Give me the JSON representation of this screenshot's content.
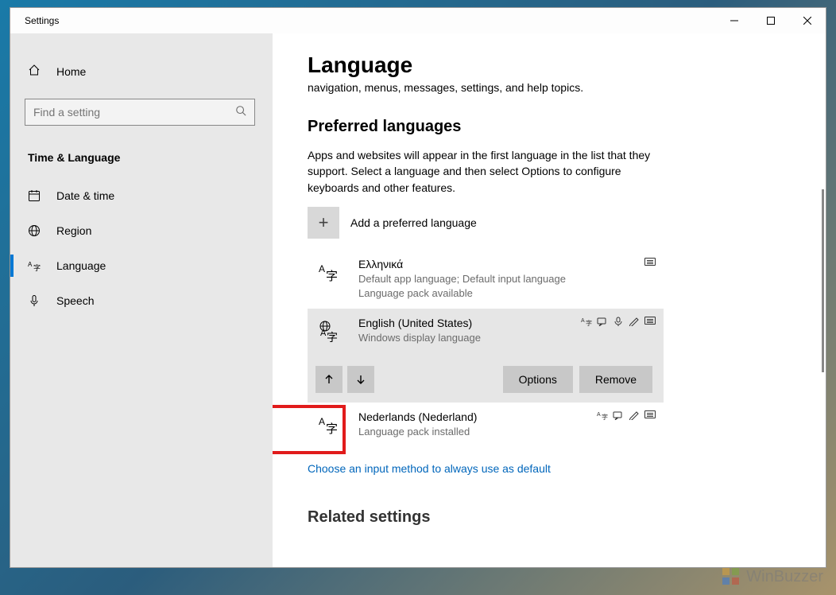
{
  "window": {
    "title": "Settings"
  },
  "sidebar": {
    "home": "Home",
    "search_placeholder": "Find a setting",
    "category": "Time & Language",
    "items": [
      {
        "label": "Date & time",
        "icon": "calendar"
      },
      {
        "label": "Region",
        "icon": "globe"
      },
      {
        "label": "Language",
        "icon": "language",
        "active": true
      },
      {
        "label": "Speech",
        "icon": "mic"
      }
    ]
  },
  "page": {
    "title": "Language",
    "pending_line": "navigation, menus, messages, settings, and help topics.",
    "section_heading": "Preferred languages",
    "section_desc": "Apps and websites will appear in the first language in the list that they support. Select a language and then select Options to configure keyboards and other features.",
    "add_language_label": "Add a preferred language",
    "languages": [
      {
        "name": "Ελληνικά",
        "sub1": "Default app language; Default input language",
        "sub2": "Language pack available",
        "badges": [
          "keyboard"
        ]
      },
      {
        "name": "English (United States)",
        "sub1": "Windows display language",
        "badges": [
          "display",
          "tts",
          "speech",
          "handwriting",
          "keyboard"
        ],
        "selected": true
      },
      {
        "name": "Nederlands (Nederland)",
        "sub1": "Language pack installed",
        "badges": [
          "display",
          "tts",
          "handwriting",
          "keyboard"
        ]
      }
    ],
    "actions": {
      "options": "Options",
      "remove": "Remove"
    },
    "link_text": "Choose an input method to always use as default",
    "related_heading": "Related settings"
  },
  "watermark": "WinBuzzer"
}
